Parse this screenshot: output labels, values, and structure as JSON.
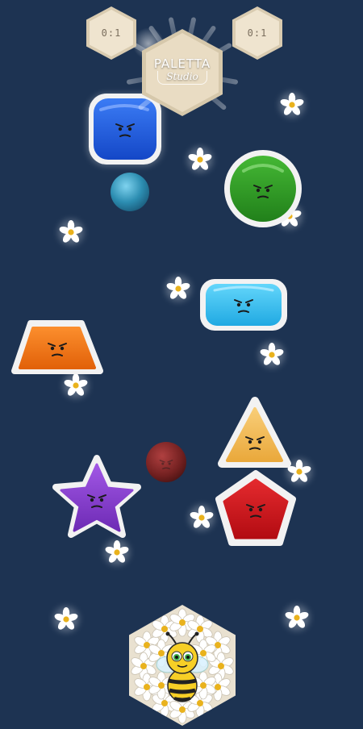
{
  "scores": {
    "left": "0:1",
    "right": "0:1"
  },
  "logo": {
    "title": "PALETTA",
    "subtitle": "Studio"
  },
  "colors": {
    "background": "#1d3352",
    "blue": "#1e5fe0",
    "green": "#2e9e24",
    "cyan": "#37c3f0",
    "orange": "#f07512",
    "yellow": "#f5bd5a",
    "purple": "#8a3fd0",
    "red": "#d2141c"
  },
  "characters": [
    {
      "name": "blue-square-face",
      "shape": "rounded-square",
      "color": "blue",
      "expression": "angry"
    },
    {
      "name": "green-circle-face",
      "shape": "circle",
      "color": "green",
      "expression": "angry"
    },
    {
      "name": "cyan-rectangle-face",
      "shape": "rounded-rectangle",
      "color": "cyan",
      "expression": "angry"
    },
    {
      "name": "orange-trapezoid-face",
      "shape": "trapezoid",
      "color": "orange",
      "expression": "angry"
    },
    {
      "name": "yellow-triangle-face",
      "shape": "triangle",
      "color": "yellow",
      "expression": "angry"
    },
    {
      "name": "purple-star-face",
      "shape": "star",
      "color": "purple",
      "expression": "angry"
    },
    {
      "name": "red-pentagon-face",
      "shape": "pentagon",
      "color": "red",
      "expression": "angry"
    }
  ],
  "balls": [
    {
      "name": "blue-ball",
      "color": "#2a8fb0"
    },
    {
      "name": "red-ball",
      "color": "#7a2020"
    }
  ],
  "decorations": {
    "flower_icon": "daisy-icon",
    "player_icon": "bee-icon"
  }
}
